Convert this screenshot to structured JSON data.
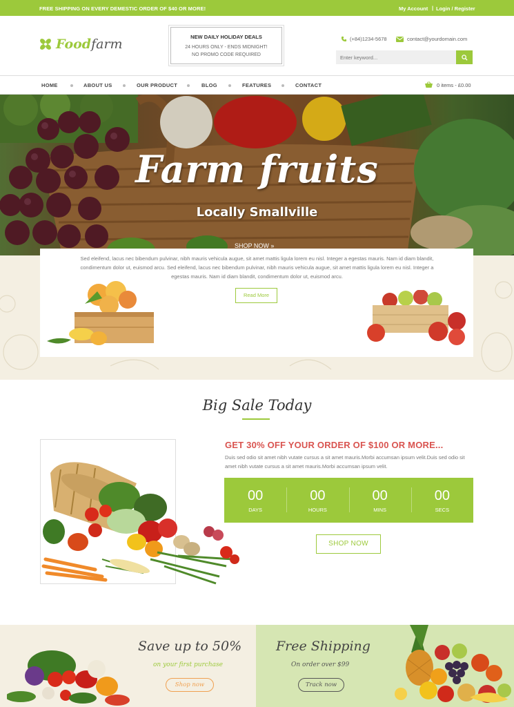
{
  "topbar": {
    "shipping": "FREE SHIPPING ON EVERY DEMESTIC ORDER OF $40 OR MORE!",
    "account": "My Account",
    "separator": "|",
    "login": "Login / Register"
  },
  "header": {
    "logo_part1": "Food",
    "logo_part2": "farm",
    "deals_title": "NEW DAILY HOLIDAY DEALS",
    "deals_line2": "24 HOURS ONLY - ENDS MIDNIGHT!",
    "deals_line3": "NO PROMO CODE REQUIRED",
    "phone": "(+84)1234-5678",
    "email": "contact@yourdomain.com",
    "search_placeholder": "Enter keyword..."
  },
  "nav": {
    "items": [
      "HOME",
      "ABOUT US",
      "OUR PRODUCT",
      "BLOG",
      "FEATURES",
      "CONTACT"
    ],
    "cart": "0 items - £0.00"
  },
  "hero": {
    "title": "Farm fruits",
    "subtitle": "Locally Smallville",
    "cta": "SHOP NOW »"
  },
  "intro": {
    "text": "Sed eleifend, lacus nec bibendum pulvinar, nibh mauris vehicula augue, sit amet mattis ligula lorem eu nisl. Integer a egestas mauris. Nam id diam blandit, condimentum dolor ut, euismod arcu. Sed eleifend, lacus nec bibendum pulvinar, nibh mauris vehicula augue, sit amet mattis ligula lorem eu nisl. Integer a egestas mauris. Nam id diam blandit, condimentum dolor ut, euismod arcu.",
    "read_more": "Read More"
  },
  "sale": {
    "heading": "Big Sale Today",
    "offer_title": "GET 30% OFF YOUR ORDER OF $100 OR MORE...",
    "offer_desc": "Duis sed odio sit amet nibh vutate cursus a sit amet mauris.Morbi accumsan ipsum velit.Duis sed odio sit amet nibh vutate cursus a sit amet mauris.Morbi accumsan ipsum velit.",
    "countdown": [
      {
        "value": "00",
        "label": "DAYS"
      },
      {
        "value": "00",
        "label": "HOURS"
      },
      {
        "value": "00",
        "label": "MINS"
      },
      {
        "value": "00",
        "label": "SECS"
      }
    ],
    "shop_now": "SHOP NOW"
  },
  "banners": {
    "left": {
      "title": "Save up to 50%",
      "subtitle": "on your first purchase",
      "button": "Shop now"
    },
    "right": {
      "title": "Free Shipping",
      "subtitle": "On order over $99",
      "button": "Track now"
    }
  },
  "colors": {
    "accent": "#9cc93b",
    "offer_red": "#d9534f",
    "cream": "#f4efe2",
    "light_green": "#d6e6b3"
  }
}
